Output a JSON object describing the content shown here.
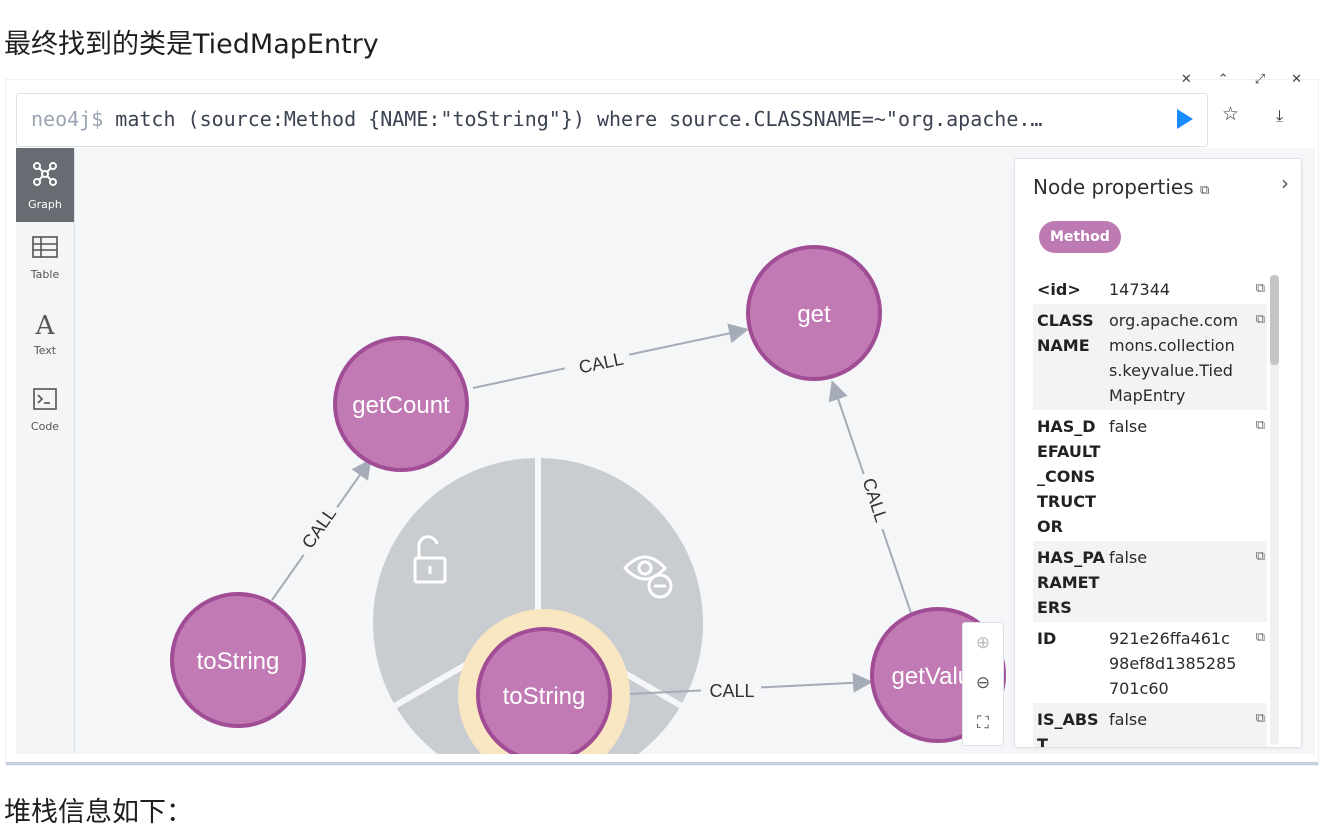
{
  "article": {
    "heading_top": "最终找到的类是TiedMapEntry",
    "heading_bottom": "堆栈信息如下："
  },
  "editor": {
    "prompt": "neo4j$",
    "query": "match (source:Method {NAME:\"toString\"}) where source.CLASSNAME=~\"org.apache.…"
  },
  "sidebar": {
    "items": [
      {
        "label": "Graph",
        "icon": "graph-icon"
      },
      {
        "label": "Table",
        "icon": "table-icon"
      },
      {
        "label": "Text",
        "icon": "text-icon"
      },
      {
        "label": "Code",
        "icon": "code-icon"
      }
    ]
  },
  "graph": {
    "nodes": {
      "getCount": "getCount",
      "get": "get",
      "toString_left": "toString",
      "toString_center": "toString",
      "getValue": "getValue"
    },
    "edge_label": "CALL"
  },
  "panel": {
    "title": "Node properties",
    "label_badge": "Method",
    "properties": [
      {
        "key": "<id>",
        "value": "147344"
      },
      {
        "key": "CLASSNAME",
        "value": "org.apache.commons.collections.keyvalue.TiedMapEntry"
      },
      {
        "key": "HAS_DEFAULT_CONSTRUCTOR",
        "value": "false"
      },
      {
        "key": "HAS_PARAMETERS",
        "value": "false"
      },
      {
        "key": "ID",
        "value": "921e26ffa461c98ef8d1385285701c60"
      },
      {
        "key": "IS_ABST",
        "value": "false"
      }
    ]
  },
  "colors": {
    "node_fill": "#c17ab3",
    "node_stroke": "#a04d96",
    "edge": "#a5acb8",
    "selection_ring": "#f9e7c2",
    "radial_menu": "#c9ccd1"
  }
}
